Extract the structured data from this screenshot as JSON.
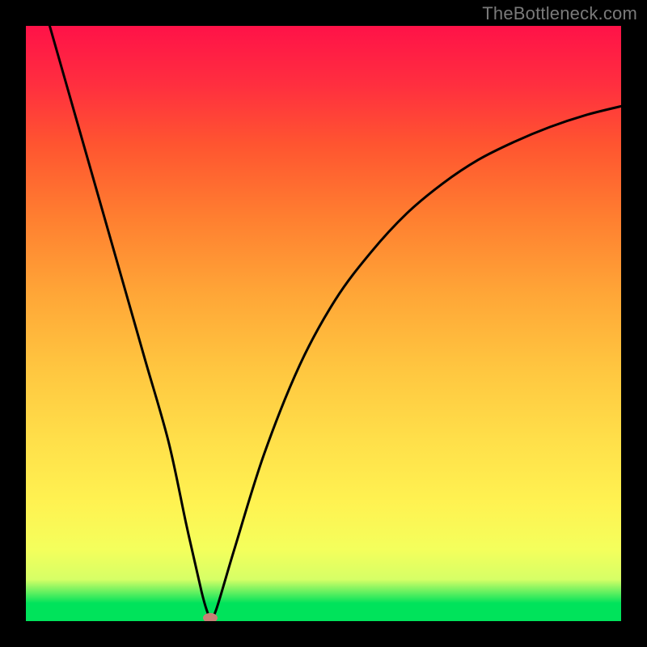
{
  "watermark": "TheBottleneck.com",
  "chart_data": {
    "type": "line",
    "title": "",
    "xlabel": "",
    "ylabel": "",
    "xlim": [
      0,
      100
    ],
    "ylim": [
      0,
      100
    ],
    "grid": false,
    "legend": false,
    "series": [
      {
        "name": "bottleneck-curve",
        "x": [
          4,
          8,
          12,
          16,
          20,
          24,
          27,
          29.5,
          30.5,
          31,
          32,
          35,
          40,
          46,
          52,
          58,
          64,
          70,
          76,
          82,
          88,
          94,
          100
        ],
        "values": [
          100,
          86,
          72,
          58,
          44,
          30,
          16,
          5,
          1.5,
          0.5,
          2,
          12,
          28,
          43,
          54,
          62,
          68.5,
          73.5,
          77.5,
          80.5,
          83,
          85,
          86.5
        ]
      }
    ],
    "marker": {
      "x": 31,
      "y": 0.5,
      "color": "#c98076"
    },
    "background_gradient": {
      "stops": [
        {
          "pos": 0.0,
          "color": "#00e35b"
        },
        {
          "pos": 0.03,
          "color": "#00e35b"
        },
        {
          "pos": 0.07,
          "color": "#d6ff66"
        },
        {
          "pos": 0.12,
          "color": "#f4ff5c"
        },
        {
          "pos": 0.2,
          "color": "#fff251"
        },
        {
          "pos": 0.3,
          "color": "#ffe04a"
        },
        {
          "pos": 0.42,
          "color": "#ffc740"
        },
        {
          "pos": 0.55,
          "color": "#ffa637"
        },
        {
          "pos": 0.68,
          "color": "#ff7e30"
        },
        {
          "pos": 0.8,
          "color": "#ff5530"
        },
        {
          "pos": 0.9,
          "color": "#ff2f3f"
        },
        {
          "pos": 1.0,
          "color": "#ff1248"
        }
      ]
    }
  }
}
